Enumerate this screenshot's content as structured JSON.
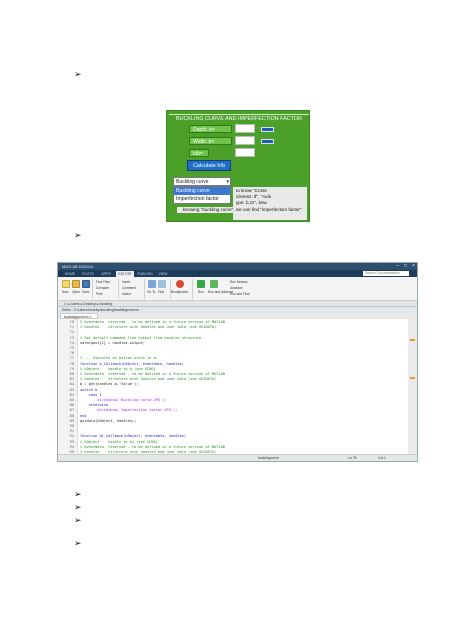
{
  "bullet_glyph": "➢",
  "gui": {
    "title": "BUCKLING CURVE AND IMPERFECTION FACTOR",
    "depth_label": "Depth: b=",
    "width_label": "Width: b=",
    "ratio_label": "h/b=",
    "calc_button": "Calculate h/b",
    "dropdown_value": "Buckling curve",
    "dropdown_options": [
      "Buckling curve",
      "Imperfection factor"
    ],
    "note_lines": [
      "to know \"Cross",
      "ickness: tf\", \"Axis",
      "ype: b,zz\", knw"
    ],
    "note_tail": "knowing \"buckling curve\", we can find \"imperfection factor\"",
    "colors": {
      "panel": "#4aa028",
      "button": "#1f6fc8"
    }
  },
  "matlab": {
    "title": "MATLAB R2016a",
    "tabs": [
      "HOME",
      "PLOTS",
      "APPS",
      "EDITOR",
      "PUBLISH",
      "VIEW"
    ],
    "active_tab": "EDITOR",
    "search_placeholder": "Search Documentation",
    "ribbon": {
      "file": [
        "New",
        "Open",
        "Save"
      ],
      "navigate": [
        "Find Files",
        "Compare",
        "Print"
      ],
      "edit": [
        "Insert",
        "Comment",
        "Indent"
      ],
      "go": [
        "Go To",
        "Find"
      ],
      "breakpoints": "Breakpoints",
      "run": [
        "Run",
        "Run and Advance",
        "Run Section",
        "Advance",
        "Run and Time"
      ]
    },
    "path": "C: ▸ Users ▸ Desktop ▸ buckling",
    "editor_bar": "Editor - C:\\Users\\Desktop\\buckling\\bucklingcurve.m",
    "file_tab": "bucklingcurve.m ×",
    "code": [
      {
        "n": "70",
        "t": "% eventdata  reserved - to be defined in a future version of MATLAB",
        "k": "comment"
      },
      {
        "n": "71",
        "t": "% handles    structure with handles and user data (see GUIDATA)",
        "k": "comment"
      },
      {
        "n": "72",
        "t": "",
        "k": ""
      },
      {
        "n": "73",
        "t": "% Get default command line output from handles structure",
        "k": "comment"
      },
      {
        "n": "74",
        "t": "varargout{1} = handles.output;",
        "k": "",
        "dash": true
      },
      {
        "n": "75",
        "t": "",
        "k": ""
      },
      {
        "n": "76",
        "t": "",
        "k": ""
      },
      {
        "n": "77",
        "t": "% --- Executes on button press in b.",
        "k": "comment"
      },
      {
        "n": "78",
        "t": "function b_Callback(hObject, eventdata, handles)",
        "k": "kw"
      },
      {
        "n": "79",
        "t": "% hObject    handle to b (see GCBO)",
        "k": "comment"
      },
      {
        "n": "80",
        "t": "% eventdata  reserved - to be defined in a future version of MATLAB",
        "k": "comment"
      },
      {
        "n": "81",
        "t": "% handles    structure with handles and user data (see GUIDATA)",
        "k": "comment"
      },
      {
        "n": "82",
        "t": "b = get(handles.b,'Value');",
        "k": "",
        "dash": true
      },
      {
        "n": "83",
        "t": "switch b",
        "k": "kw",
        "dash": true
      },
      {
        "n": "84",
        "t": "    case 1",
        "k": "kw"
      },
      {
        "n": "85",
        "t": "        a1=imshow('Buckling curve.JPG');",
        "k": "str",
        "dash": true
      },
      {
        "n": "86",
        "t": "    otherwise",
        "k": "kw"
      },
      {
        "n": "87",
        "t": "        a2=imshow('Imperfection factor.JPG');",
        "k": "str",
        "dash": true
      },
      {
        "n": "88",
        "t": "end",
        "k": "kw"
      },
      {
        "n": "89",
        "t": "guidata(hObject, handles);",
        "k": "",
        "dash": true
      },
      {
        "n": "90",
        "t": "",
        "k": ""
      },
      {
        "n": "91",
        "t": "",
        "k": ""
      },
      {
        "n": "92",
        "t": "function b1_Callback(hObject, eventdata, handles)",
        "k": "kw"
      },
      {
        "n": "93",
        "t": "% hObject    handle to b1 (see GCBO)",
        "k": "comment"
      },
      {
        "n": "94",
        "t": "% eventdata  reserved - to be defined in a future version of MATLAB",
        "k": "comment"
      },
      {
        "n": "95",
        "t": "% handles    structure with handles and user data (see GUIDATA)",
        "k": "comment"
      }
    ],
    "status": {
      "left": "",
      "mode": "bucklingcurve",
      "ln": "Ln 78",
      "col": "Col 1"
    }
  }
}
